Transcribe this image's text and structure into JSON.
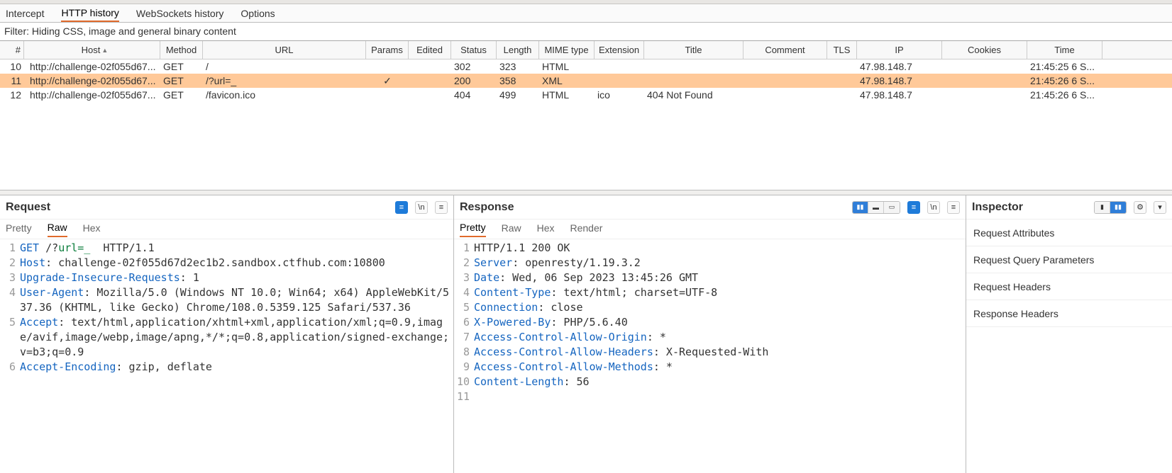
{
  "tabs": {
    "intercept": "Intercept",
    "http": "HTTP history",
    "ws": "WebSockets history",
    "options": "Options"
  },
  "filter_text": "Filter: Hiding CSS, image and general binary content",
  "columns": {
    "num": "#",
    "host": "Host",
    "method": "Method",
    "url": "URL",
    "params": "Params",
    "edited": "Edited",
    "status": "Status",
    "length": "Length",
    "mime": "MIME type",
    "ext": "Extension",
    "title": "Title",
    "comment": "Comment",
    "tls": "TLS",
    "ip": "IP",
    "cookies": "Cookies",
    "time": "Time"
  },
  "rows": [
    {
      "num": "10",
      "host": "http://challenge-02f055d67...",
      "method": "GET",
      "url": "/",
      "params": "",
      "edited": "",
      "status": "302",
      "length": "323",
      "mime": "HTML",
      "ext": "",
      "title": "",
      "comment": "",
      "tls": "",
      "ip": "47.98.148.7",
      "cookies": "",
      "time": "21:45:25 6 S...",
      "selected": false
    },
    {
      "num": "11",
      "host": "http://challenge-02f055d67...",
      "method": "GET",
      "url": "/?url=_",
      "params": "✓",
      "edited": "",
      "status": "200",
      "length": "358",
      "mime": "XML",
      "ext": "",
      "title": "",
      "comment": "",
      "tls": "",
      "ip": "47.98.148.7",
      "cookies": "",
      "time": "21:45:26 6 S...",
      "selected": true
    },
    {
      "num": "12",
      "host": "http://challenge-02f055d67...",
      "method": "GET",
      "url": "/favicon.ico",
      "params": "",
      "edited": "",
      "status": "404",
      "length": "499",
      "mime": "HTML",
      "ext": "ico",
      "title": "404 Not Found",
      "comment": "",
      "tls": "",
      "ip": "47.98.148.7",
      "cookies": "",
      "time": "21:45:26 6 S...",
      "selected": false
    }
  ],
  "request": {
    "title": "Request",
    "subtabs": {
      "pretty": "Pretty",
      "raw": "Raw",
      "hex": "Hex"
    },
    "active_sub": "raw",
    "lines": [
      {
        "n": "1",
        "html": "<span class='tok-m'>GET</span> /?<span class='tok-p'>url=_</span>  HTTP/1.1"
      },
      {
        "n": "2",
        "html": "<span class='tok-h'>Host</span>: challenge-02f055d67d2ec1b2.sandbox.ctfhub.com:10800"
      },
      {
        "n": "3",
        "html": "<span class='tok-h'>Upgrade-Insecure-Requests</span>: 1"
      },
      {
        "n": "4",
        "html": "<span class='tok-h'>User-Agent</span>: Mozilla/5.0 (Windows NT 10.0; Win64; x64) AppleWebKit/537.36 (KHTML, like Gecko) Chrome/108.0.5359.125 Safari/537.36"
      },
      {
        "n": "5",
        "html": "<span class='tok-h'>Accept</span>: text/html,application/xhtml+xml,application/xml;q=0.9,image/avif,image/webp,image/apng,*/*;q=0.8,application/signed-exchange;v=b3;q=0.9"
      },
      {
        "n": "6",
        "html": "<span class='tok-h'>Accept-Encoding</span>: gzip, deflate"
      }
    ]
  },
  "response": {
    "title": "Response",
    "subtabs": {
      "pretty": "Pretty",
      "raw": "Raw",
      "hex": "Hex",
      "render": "Render"
    },
    "active_sub": "pretty",
    "lines": [
      {
        "n": "1",
        "html": "HTTP/1.1 200 OK"
      },
      {
        "n": "2",
        "html": "<span class='tok-h'>Server</span>: openresty/1.19.3.2"
      },
      {
        "n": "3",
        "html": "<span class='tok-h'>Date</span>: Wed, 06 Sep 2023 13:45:26 GMT"
      },
      {
        "n": "4",
        "html": "<span class='tok-h'>Content-Type</span>: text/html; charset=UTF-8"
      },
      {
        "n": "5",
        "html": "<span class='tok-h'>Connection</span>: close"
      },
      {
        "n": "6",
        "html": "<span class='tok-h'>X-Powered-By</span>: PHP/5.6.40"
      },
      {
        "n": "7",
        "html": "<span class='tok-h'>Access-Control-Allow-Origin</span>: *"
      },
      {
        "n": "8",
        "html": "<span class='tok-h'>Access-Control-Allow-Headers</span>: X-Requested-With"
      },
      {
        "n": "9",
        "html": "<span class='tok-h'>Access-Control-Allow-Methods</span>: *"
      },
      {
        "n": "10",
        "html": "<span class='tok-h'>Content-Length</span>: 56"
      },
      {
        "n": "11",
        "html": ""
      }
    ]
  },
  "inspector": {
    "title": "Inspector",
    "sections": [
      {
        "label": "Request Attributes",
        "count": ""
      },
      {
        "label": "Request Query Parameters",
        "count": ""
      },
      {
        "label": "Request Headers",
        "count": ""
      },
      {
        "label": "Response Headers",
        "count": ""
      }
    ]
  },
  "icons": {
    "wrap": "\\n",
    "menu": "≡",
    "actions": "≡"
  }
}
